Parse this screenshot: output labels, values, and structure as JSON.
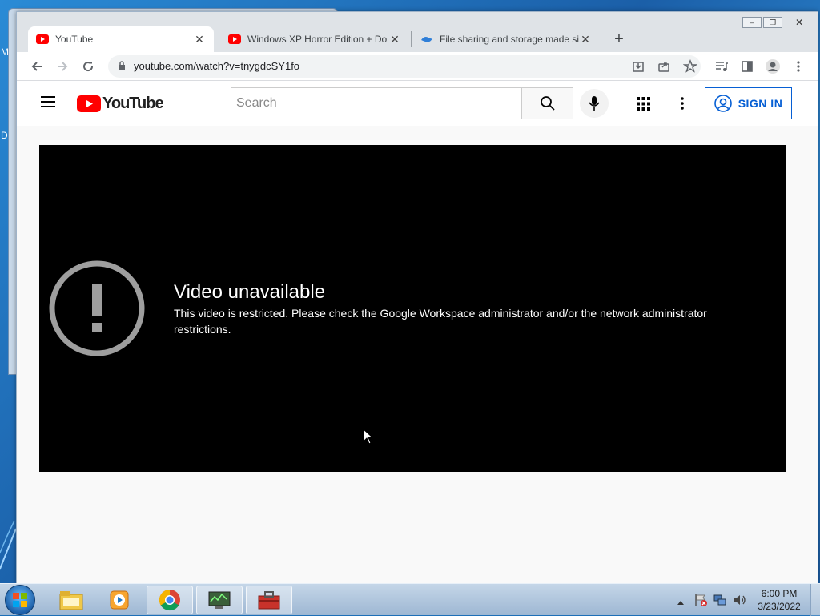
{
  "desktop": {
    "edge_letters": [
      "M",
      "D"
    ]
  },
  "browser": {
    "tabs": [
      {
        "title": "YouTube",
        "icon": "youtube-icon",
        "active": true
      },
      {
        "title": "Windows XP Horror Edition + Do",
        "icon": "youtube-icon",
        "active": false
      },
      {
        "title": "File sharing and storage made sir",
        "icon": "fileshare-icon",
        "active": false
      }
    ],
    "new_tab": "+",
    "window_controls": {
      "minimize": "–",
      "restore": "❐",
      "close": "✕"
    },
    "url": "youtube.com/watch?v=tnygdcSY1fo",
    "toolbar_icons": [
      "back-icon",
      "forward-icon",
      "reload-icon",
      "lock-icon",
      "install-icon",
      "share-icon",
      "bookmark-star-icon",
      "media-control-icon",
      "side-panel-icon",
      "profile-icon",
      "menu-dots-icon"
    ]
  },
  "youtube": {
    "logo_text": "YouTube",
    "search_placeholder": "Search",
    "signin_label": "SIGN IN",
    "error_title": "Video unavailable",
    "error_message": "This video is restricted. Please check the Google Workspace administrator and/or the network administrator restrictions."
  },
  "taskbar": {
    "items": [
      "start-orb",
      "explorer",
      "media-player",
      "chrome",
      "network-tool",
      "toolbox"
    ],
    "clock_time": "6:00 PM",
    "clock_date": "3/23/2022"
  },
  "colors": {
    "youtube_red": "#ff0000",
    "signin_blue": "#065fd4",
    "player_bg": "#000000"
  }
}
